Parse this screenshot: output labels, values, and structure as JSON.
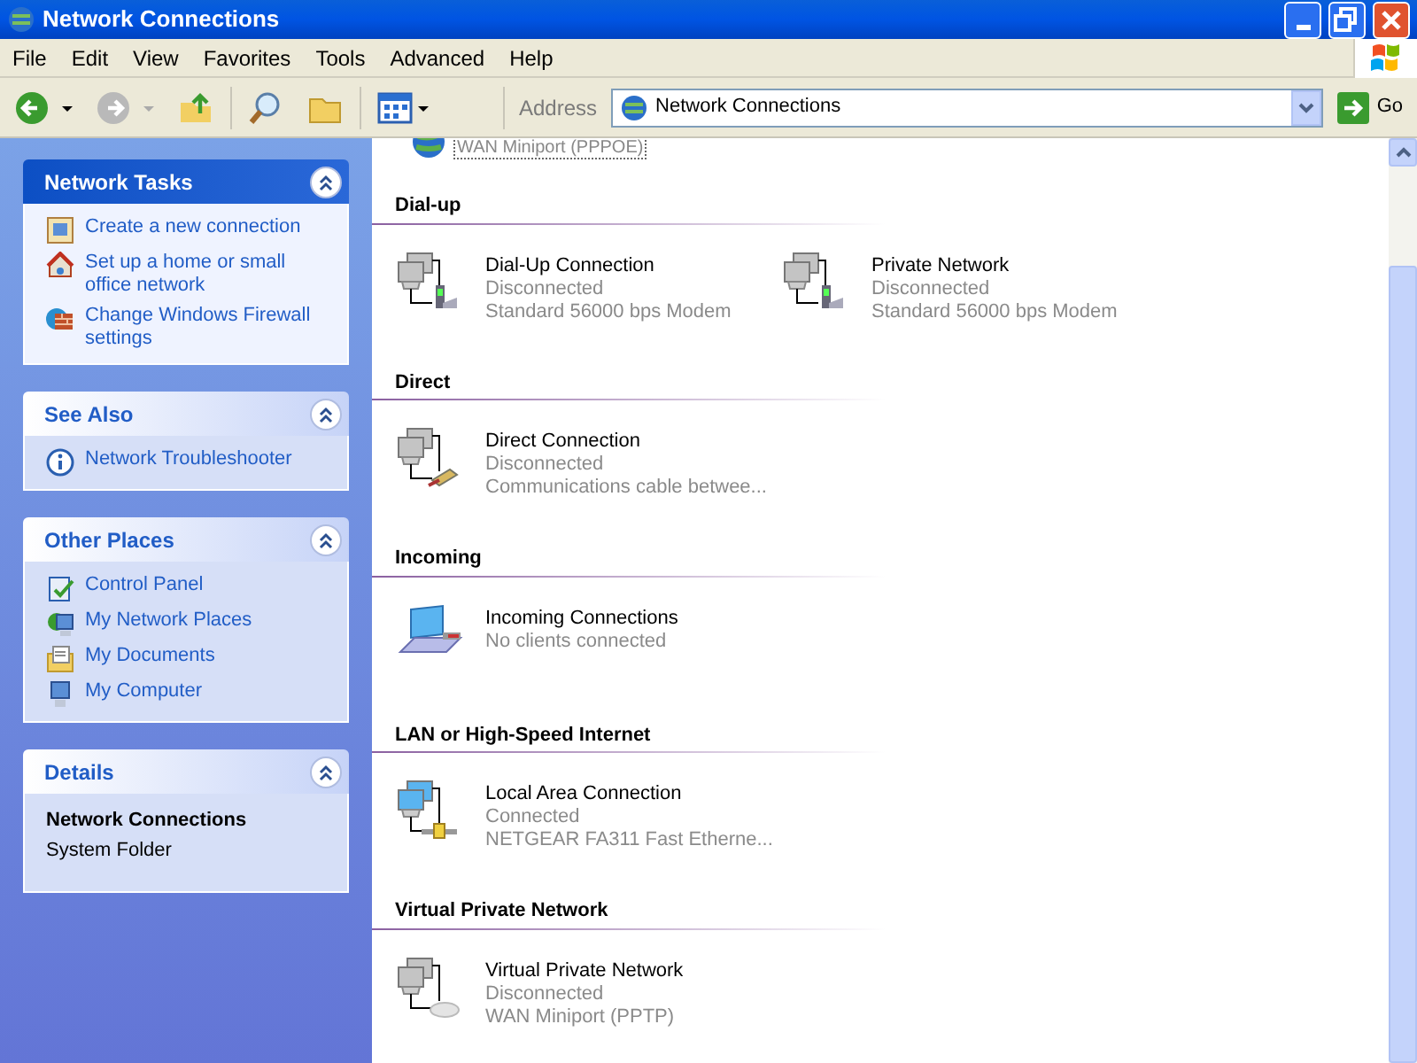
{
  "window": {
    "title": "Network Connections"
  },
  "menu": [
    "File",
    "Edit",
    "View",
    "Favorites",
    "Tools",
    "Advanced",
    "Help"
  ],
  "address_bar": {
    "label": "Address",
    "value": "Network Connections",
    "go": "Go"
  },
  "sidebar": [
    {
      "kind": "special",
      "title": "Network Tasks",
      "expanded": true,
      "items": [
        {
          "kind": "wizard",
          "label": "Create a new connection"
        },
        {
          "kind": "home",
          "label": "Set up a home or small office network"
        },
        {
          "kind": "firewall",
          "label": "Change Windows Firewall settings"
        }
      ]
    },
    {
      "kind": "normal",
      "title": "See Also",
      "expanded": true,
      "items": [
        {
          "kind": "info",
          "label": "Network Troubleshooter"
        }
      ]
    },
    {
      "kind": "normal",
      "title": "Other Places",
      "expanded": true,
      "items": [
        {
          "kind": "control",
          "label": "Control Panel"
        },
        {
          "kind": "network",
          "label": "My Network Places"
        },
        {
          "kind": "documents",
          "label": "My Documents"
        },
        {
          "kind": "computer",
          "label": "My Computer"
        }
      ]
    },
    {
      "kind": "details",
      "title": "Details",
      "expanded": true,
      "name": "Network Connections",
      "subtitle": "System Folder"
    }
  ],
  "partial_item": {
    "kind": "wan",
    "detail": "WAN Miniport (PPPOE)"
  },
  "groups": [
    {
      "title": "Dial-up",
      "items": [
        {
          "kind": "modem",
          "name": "Dial-Up Connection",
          "status": "Disconnected",
          "device": "Standard 56000 bps Modem"
        },
        {
          "kind": "modem",
          "name": "Private Network",
          "status": "Disconnected",
          "device": "Standard 56000 bps Modem"
        }
      ]
    },
    {
      "title": "Direct",
      "items": [
        {
          "kind": "cable",
          "name": "Direct Connection",
          "status": "Disconnected",
          "device": "Communications cable betwee..."
        }
      ]
    },
    {
      "title": "Incoming",
      "items": [
        {
          "kind": "incoming",
          "name": "Incoming Connections",
          "status": "No clients connected"
        }
      ]
    },
    {
      "title": "LAN or High-Speed Internet",
      "items": [
        {
          "kind": "lan",
          "name": "Local Area Connection",
          "status": "Connected",
          "device": "NETGEAR FA311 Fast Etherne..."
        }
      ]
    },
    {
      "title": "Virtual Private Network",
      "items": [
        {
          "kind": "vpn",
          "name": "Virtual Private Network",
          "status": "Disconnected",
          "device": "WAN Miniport (PPTP)"
        }
      ]
    }
  ]
}
